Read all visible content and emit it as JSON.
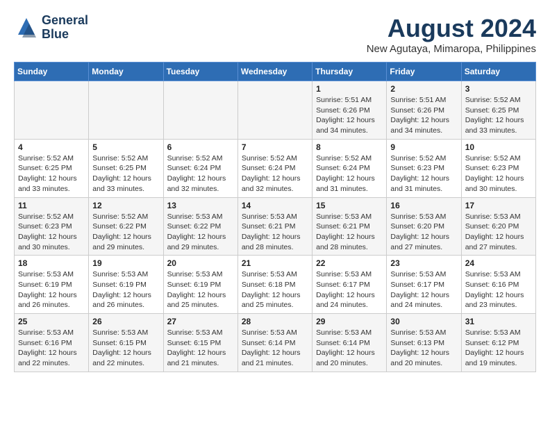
{
  "header": {
    "logo_line1": "General",
    "logo_line2": "Blue",
    "month_year": "August 2024",
    "location": "New Agutaya, Mimaropa, Philippines"
  },
  "weekdays": [
    "Sunday",
    "Monday",
    "Tuesday",
    "Wednesday",
    "Thursday",
    "Friday",
    "Saturday"
  ],
  "weeks": [
    [
      {
        "day": "",
        "detail": ""
      },
      {
        "day": "",
        "detail": ""
      },
      {
        "day": "",
        "detail": ""
      },
      {
        "day": "",
        "detail": ""
      },
      {
        "day": "1",
        "detail": "Sunrise: 5:51 AM\nSunset: 6:26 PM\nDaylight: 12 hours\nand 34 minutes."
      },
      {
        "day": "2",
        "detail": "Sunrise: 5:51 AM\nSunset: 6:26 PM\nDaylight: 12 hours\nand 34 minutes."
      },
      {
        "day": "3",
        "detail": "Sunrise: 5:52 AM\nSunset: 6:25 PM\nDaylight: 12 hours\nand 33 minutes."
      }
    ],
    [
      {
        "day": "4",
        "detail": "Sunrise: 5:52 AM\nSunset: 6:25 PM\nDaylight: 12 hours\nand 33 minutes."
      },
      {
        "day": "5",
        "detail": "Sunrise: 5:52 AM\nSunset: 6:25 PM\nDaylight: 12 hours\nand 33 minutes."
      },
      {
        "day": "6",
        "detail": "Sunrise: 5:52 AM\nSunset: 6:24 PM\nDaylight: 12 hours\nand 32 minutes."
      },
      {
        "day": "7",
        "detail": "Sunrise: 5:52 AM\nSunset: 6:24 PM\nDaylight: 12 hours\nand 32 minutes."
      },
      {
        "day": "8",
        "detail": "Sunrise: 5:52 AM\nSunset: 6:24 PM\nDaylight: 12 hours\nand 31 minutes."
      },
      {
        "day": "9",
        "detail": "Sunrise: 5:52 AM\nSunset: 6:23 PM\nDaylight: 12 hours\nand 31 minutes."
      },
      {
        "day": "10",
        "detail": "Sunrise: 5:52 AM\nSunset: 6:23 PM\nDaylight: 12 hours\nand 30 minutes."
      }
    ],
    [
      {
        "day": "11",
        "detail": "Sunrise: 5:52 AM\nSunset: 6:23 PM\nDaylight: 12 hours\nand 30 minutes."
      },
      {
        "day": "12",
        "detail": "Sunrise: 5:52 AM\nSunset: 6:22 PM\nDaylight: 12 hours\nand 29 minutes."
      },
      {
        "day": "13",
        "detail": "Sunrise: 5:53 AM\nSunset: 6:22 PM\nDaylight: 12 hours\nand 29 minutes."
      },
      {
        "day": "14",
        "detail": "Sunrise: 5:53 AM\nSunset: 6:21 PM\nDaylight: 12 hours\nand 28 minutes."
      },
      {
        "day": "15",
        "detail": "Sunrise: 5:53 AM\nSunset: 6:21 PM\nDaylight: 12 hours\nand 28 minutes."
      },
      {
        "day": "16",
        "detail": "Sunrise: 5:53 AM\nSunset: 6:20 PM\nDaylight: 12 hours\nand 27 minutes."
      },
      {
        "day": "17",
        "detail": "Sunrise: 5:53 AM\nSunset: 6:20 PM\nDaylight: 12 hours\nand 27 minutes."
      }
    ],
    [
      {
        "day": "18",
        "detail": "Sunrise: 5:53 AM\nSunset: 6:19 PM\nDaylight: 12 hours\nand 26 minutes."
      },
      {
        "day": "19",
        "detail": "Sunrise: 5:53 AM\nSunset: 6:19 PM\nDaylight: 12 hours\nand 26 minutes."
      },
      {
        "day": "20",
        "detail": "Sunrise: 5:53 AM\nSunset: 6:19 PM\nDaylight: 12 hours\nand 25 minutes."
      },
      {
        "day": "21",
        "detail": "Sunrise: 5:53 AM\nSunset: 6:18 PM\nDaylight: 12 hours\nand 25 minutes."
      },
      {
        "day": "22",
        "detail": "Sunrise: 5:53 AM\nSunset: 6:17 PM\nDaylight: 12 hours\nand 24 minutes."
      },
      {
        "day": "23",
        "detail": "Sunrise: 5:53 AM\nSunset: 6:17 PM\nDaylight: 12 hours\nand 24 minutes."
      },
      {
        "day": "24",
        "detail": "Sunrise: 5:53 AM\nSunset: 6:16 PM\nDaylight: 12 hours\nand 23 minutes."
      }
    ],
    [
      {
        "day": "25",
        "detail": "Sunrise: 5:53 AM\nSunset: 6:16 PM\nDaylight: 12 hours\nand 22 minutes."
      },
      {
        "day": "26",
        "detail": "Sunrise: 5:53 AM\nSunset: 6:15 PM\nDaylight: 12 hours\nand 22 minutes."
      },
      {
        "day": "27",
        "detail": "Sunrise: 5:53 AM\nSunset: 6:15 PM\nDaylight: 12 hours\nand 21 minutes."
      },
      {
        "day": "28",
        "detail": "Sunrise: 5:53 AM\nSunset: 6:14 PM\nDaylight: 12 hours\nand 21 minutes."
      },
      {
        "day": "29",
        "detail": "Sunrise: 5:53 AM\nSunset: 6:14 PM\nDaylight: 12 hours\nand 20 minutes."
      },
      {
        "day": "30",
        "detail": "Sunrise: 5:53 AM\nSunset: 6:13 PM\nDaylight: 12 hours\nand 20 minutes."
      },
      {
        "day": "31",
        "detail": "Sunrise: 5:53 AM\nSunset: 6:12 PM\nDaylight: 12 hours\nand 19 minutes."
      }
    ]
  ]
}
